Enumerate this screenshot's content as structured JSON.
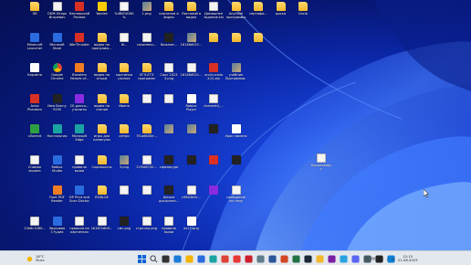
{
  "desktop": {
    "icons": [
      {
        "label": "Л8",
        "kind": "folder"
      },
      {
        "label": "ОБЖ Игорь Игоревич",
        "kind": "file"
      },
      {
        "label": "Касперский Разное",
        "kind": "red"
      },
      {
        "label": "Yandex",
        "kind": "yellow"
      },
      {
        "label": "%4BK%D0K%",
        "kind": "file"
      },
      {
        "label": "1.png",
        "kind": "img"
      },
      {
        "label": "картинки в видео",
        "kind": "folder"
      },
      {
        "label": "Листовой в видео",
        "kind": "folder"
      },
      {
        "label": "Домашнее задание.txt",
        "kind": "file"
      },
      {
        "label": "AnyShell программы",
        "kind": "folder"
      },
      {
        "label": "сертифи...",
        "kind": "folder"
      },
      {
        "label": "доска",
        "kind": "folder"
      },
      {
        "label": "Unclo",
        "kind": "folder"
      },
      {
        "label": "Minecraft Launcher",
        "kind": "blue"
      },
      {
        "label": "Microsoft Store",
        "kind": "blue"
      },
      {
        "label": "WarThunder",
        "kind": "red"
      },
      {
        "label": "видео по программ...",
        "kind": "folder"
      },
      {
        "label": "Ф...",
        "kind": "file"
      },
      {
        "label": "сочинени...",
        "kind": "file"
      },
      {
        "label": "Важное...",
        "kind": "dark"
      },
      {
        "label": "16148d021...",
        "kind": "img"
      },
      {
        "label": "",
        "kind": "folder"
      },
      {
        "label": "",
        "kind": "folder"
      },
      {
        "label": "",
        "kind": "folder"
      },
      {
        "label": "Корзина",
        "kind": "white"
      },
      {
        "label": "Google Chrome",
        "kind": "chrome"
      },
      {
        "label": "Brawlers Heroes of...",
        "kind": "orange"
      },
      {
        "label": "видео по отцам",
        "kind": "folder"
      },
      {
        "label": "картинки разное",
        "kind": "folder"
      },
      {
        "label": "ОГЭ-ЕГЭ программ",
        "kind": "folder"
      },
      {
        "label": "Сакс 2023 3.png",
        "kind": "file"
      },
      {
        "label": "16148d021...",
        "kind": "file"
      },
      {
        "label": "unclo-nado 2(1).zip",
        "kind": "red"
      },
      {
        "label": "учебник Программи...",
        "kind": "img"
      },
      {
        "label": "Avira Phantom VPN",
        "kind": "red"
      },
      {
        "label": "New Bunny ROM",
        "kind": "dark"
      },
      {
        "label": "CE-диско... утилиты",
        "kind": "purple"
      },
      {
        "label": "видео на чтение",
        "kind": "folder"
      },
      {
        "label": "Ивана",
        "kind": "folder"
      },
      {
        "label": "",
        "kind": "file"
      },
      {
        "label": "",
        "kind": "file"
      },
      {
        "label": "Roblox Player",
        "kind": "white"
      },
      {
        "label": "channeld_...",
        "kind": "file"
      },
      {
        "label": "uTorrent",
        "kind": "green"
      },
      {
        "label": "Ностальгия",
        "kind": "teal"
      },
      {
        "label": "Microsoft Edge",
        "kind": "teal"
      },
      {
        "label": "игры для каникулы",
        "kind": "folder"
      },
      {
        "label": "интро",
        "kind": "folder"
      },
      {
        "label": "7f1a6645e...",
        "kind": "folder"
      },
      {
        "label": "",
        "kind": "img"
      },
      {
        "label": "",
        "kind": "img"
      },
      {
        "label": "",
        "kind": "dark"
      },
      {
        "label": "Урок памяти",
        "kind": "white"
      },
      {
        "label": "Снимок экрана 2023-05-30...",
        "kind": "file"
      },
      {
        "label": "Roblox Studio",
        "kind": "blue"
      },
      {
        "label": "правила выжи класса",
        "kind": "file"
      },
      {
        "label": "Скриншоты",
        "kind": "folder"
      },
      {
        "label": "3.png",
        "kind": "img"
      },
      {
        "label": "11f5d6742...",
        "kind": "file"
      },
      {
        "label": "сфизикуре",
        "kind": "dark"
      },
      {
        "label": "",
        "kind": "dark"
      },
      {
        "label": "",
        "kind": "red"
      },
      {
        "label": "",
        "kind": "dark"
      },
      {
        "label": "Коронавирус",
        "kind": "file"
      },
      {
        "label": "Foxit PDF Reader",
        "kind": "orange"
      },
      {
        "label": "HP Print and Scan Doctor",
        "kind": "blue"
      },
      {
        "label": "ROBLOX",
        "kind": "folder"
      },
      {
        "label": "",
        "kind": "file"
      },
      {
        "label": "",
        "kind": "file"
      },
      {
        "label": "Школа дисципли...",
        "kind": "dark"
      },
      {
        "label": "c9843b9c...",
        "kind": "file"
      },
      {
        "label": "",
        "kind": "purple"
      },
      {
        "label": "сообщение на тему",
        "kind": "file"
      },
      {
        "label": "13e6c1080...",
        "kind": "file"
      },
      {
        "label": "Звуковая Студия",
        "kind": "blue"
      },
      {
        "label": "правила на картинках",
        "kind": "file"
      },
      {
        "label": "2b167c6b9...",
        "kind": "file"
      },
      {
        "label": "смс.png",
        "kind": "dark"
      },
      {
        "label": "стрелка.png",
        "kind": "file"
      },
      {
        "label": "правила выжи класса",
        "kind": "file"
      },
      {
        "label": "as17.png",
        "kind": "white"
      },
      {
        "label": "",
        "kind": "dark"
      }
    ]
  },
  "taskbar": {
    "weather_temp": "18°C",
    "weather_desc": "Ясно",
    "language": "РУС",
    "time": "12:15",
    "date": "21.08.2023",
    "apps": [
      "start-icon",
      "search-icon",
      "task-view-icon",
      "widgets-icon",
      "explorer-icon",
      "store-icon",
      "edge-icon",
      "chrome-icon",
      "yandex-icon",
      "opera-icon",
      "settings-icon",
      "word-icon",
      "powerpoint-icon",
      "excel-icon",
      "steam-icon",
      "folder-icon",
      "media-icon",
      "telegram-icon",
      "discord-icon",
      "calc-icon",
      "terminal-icon",
      "vscode-icon"
    ]
  },
  "colors": {
    "taskbar_bg": "#e3e8ef",
    "accent": "#1741d6"
  }
}
